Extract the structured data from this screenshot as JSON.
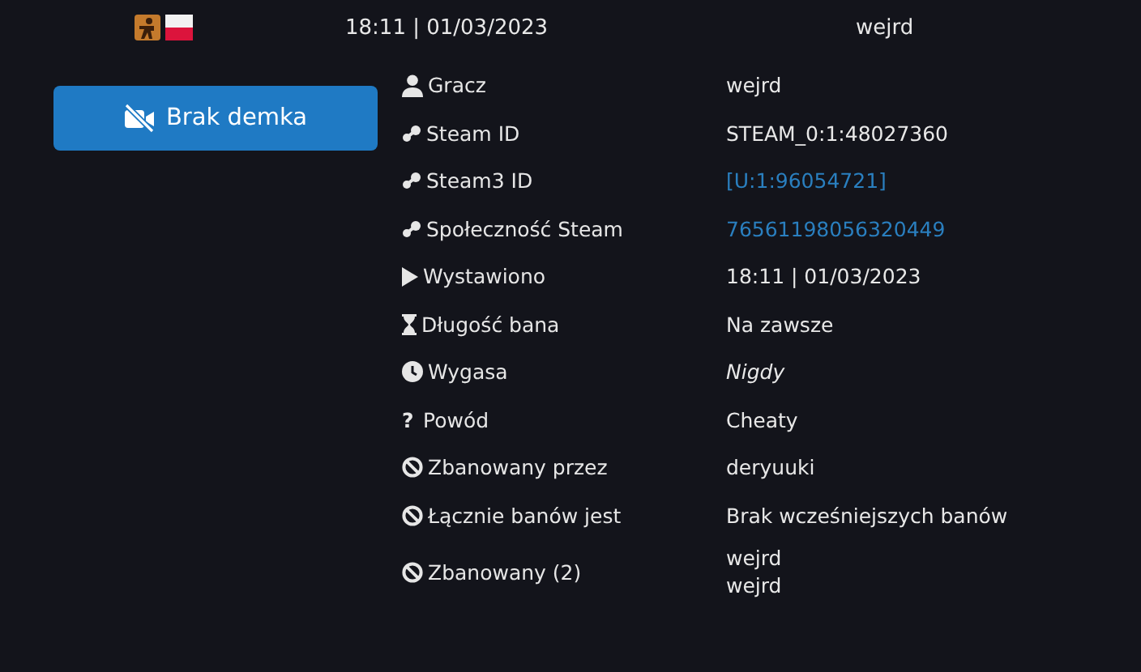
{
  "header": {
    "date": "18:11 | 01/03/2023",
    "player": "wejrd"
  },
  "demo_button": {
    "label": "Brak demka"
  },
  "rows": [
    {
      "kind": "player",
      "label": "Gracz",
      "values": [
        "wejrd"
      ]
    },
    {
      "kind": "steamid",
      "label": "Steam ID",
      "values": [
        "STEAM_0:1:48027360"
      ]
    },
    {
      "kind": "steamlink",
      "label": "Steam3 ID",
      "values": [
        "[U:1:96054721]"
      ]
    },
    {
      "kind": "steamlink",
      "label": "Społeczność Steam",
      "values": [
        "76561198056320449"
      ]
    },
    {
      "kind": "issued",
      "label": "Wystawiono",
      "values": [
        "18:11 | 01/03/2023"
      ]
    },
    {
      "kind": "length",
      "label": "Długość bana",
      "values": [
        "Na zawsze"
      ]
    },
    {
      "kind": "expires",
      "label": "Wygasa",
      "values": [
        "Nigdy"
      ]
    },
    {
      "kind": "reason",
      "glyph": "?",
      "label": "Powód",
      "values": [
        "Cheaty"
      ]
    },
    {
      "kind": "ban",
      "label": "Zbanowany przez",
      "values": [
        "deryuuki"
      ]
    },
    {
      "kind": "ban",
      "label": "Łącznie banów jest",
      "values": [
        "Brak wcześniejszych banów"
      ]
    },
    {
      "kind": "ban",
      "label": "Zbanowany (2)",
      "values": [
        "wejrd",
        "wejrd"
      ]
    }
  ]
}
